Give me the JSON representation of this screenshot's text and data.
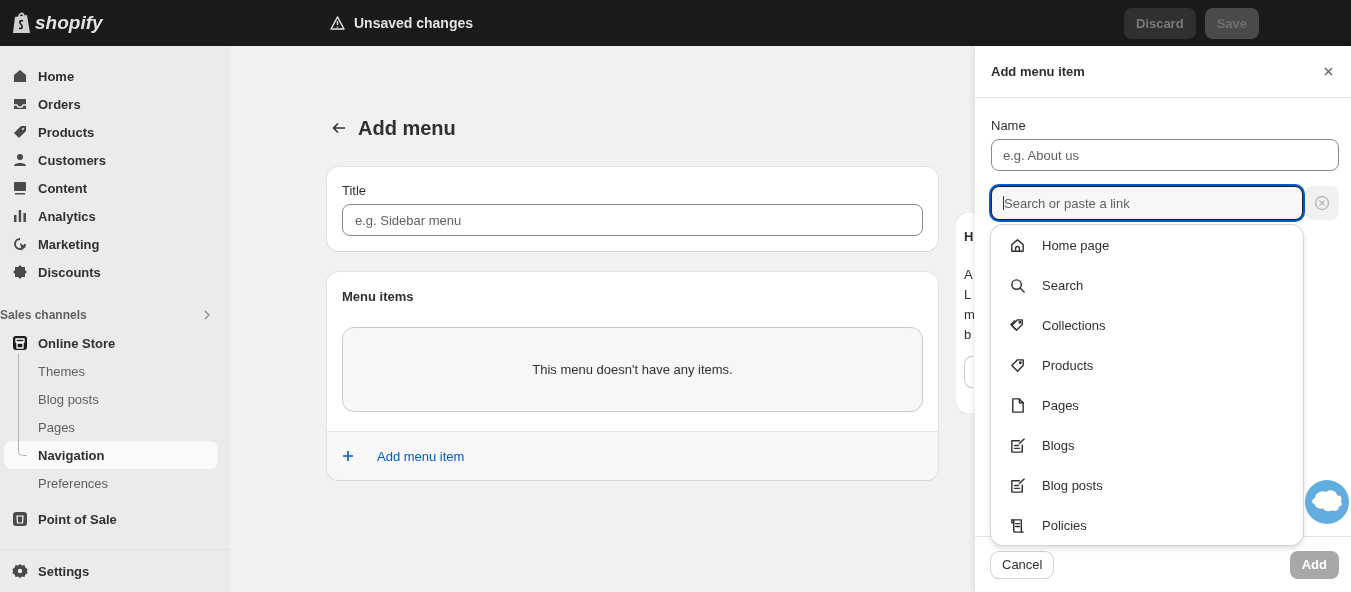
{
  "topbar": {
    "logo": "shopify",
    "status": "Unsaved changes",
    "buttons": [
      {
        "label": "Discard",
        "kind": "secondary",
        "disabled": true
      },
      {
        "label": "Save",
        "kind": "primary",
        "disabled": true
      }
    ]
  },
  "sidebar": {
    "items": [
      {
        "label": "Home",
        "selected": false
      },
      {
        "label": "Orders",
        "selected": false
      },
      {
        "label": "Products",
        "selected": false
      },
      {
        "label": "Customers",
        "selected": false
      },
      {
        "label": "Content",
        "selected": false
      },
      {
        "label": "Analytics",
        "selected": false
      },
      {
        "label": "Marketing",
        "selected": false
      },
      {
        "label": "Discounts",
        "selected": false
      }
    ],
    "sales_channels": {
      "label": "Sales channels",
      "items": [
        {
          "label": "Online Store",
          "selected": false,
          "children": [
            {
              "label": "Themes",
              "selected": false
            },
            {
              "label": "Blog posts",
              "selected": false
            },
            {
              "label": "Pages",
              "selected": false
            },
            {
              "label": "Navigation",
              "selected": true
            },
            {
              "label": "Preferences",
              "selected": false
            }
          ]
        },
        {
          "label": "Point of Sale",
          "selected": false
        }
      ]
    },
    "settings": {
      "label": "Settings"
    }
  },
  "page": {
    "title": "Add menu",
    "title_card": {
      "label": "Title",
      "placeholder": "e.g. Sidebar menu"
    },
    "menu_items_card": {
      "heading": "Menu items",
      "empty_text": "This menu doesn't have any items.",
      "add_link": "Add menu item"
    },
    "help_card": {
      "title": "H",
      "lines": [
        "A",
        "L",
        "m",
        "b"
      ]
    }
  },
  "panel": {
    "title": "Add menu item",
    "name_field": {
      "label": "Name",
      "placeholder": "e.g. About us"
    },
    "link_field": {
      "placeholder": "Search or paste a link",
      "focused": true
    },
    "dropdown": [
      {
        "label": "Home page"
      },
      {
        "label": "Search"
      },
      {
        "label": "Collections"
      },
      {
        "label": "Products"
      },
      {
        "label": "Pages"
      },
      {
        "label": "Blogs"
      },
      {
        "label": "Blog posts"
      },
      {
        "label": "Policies"
      }
    ],
    "buttons": [
      {
        "label": "Cancel",
        "kind": "secondary",
        "disabled": false
      },
      {
        "label": "Add",
        "kind": "primary",
        "disabled": true
      }
    ]
  }
}
